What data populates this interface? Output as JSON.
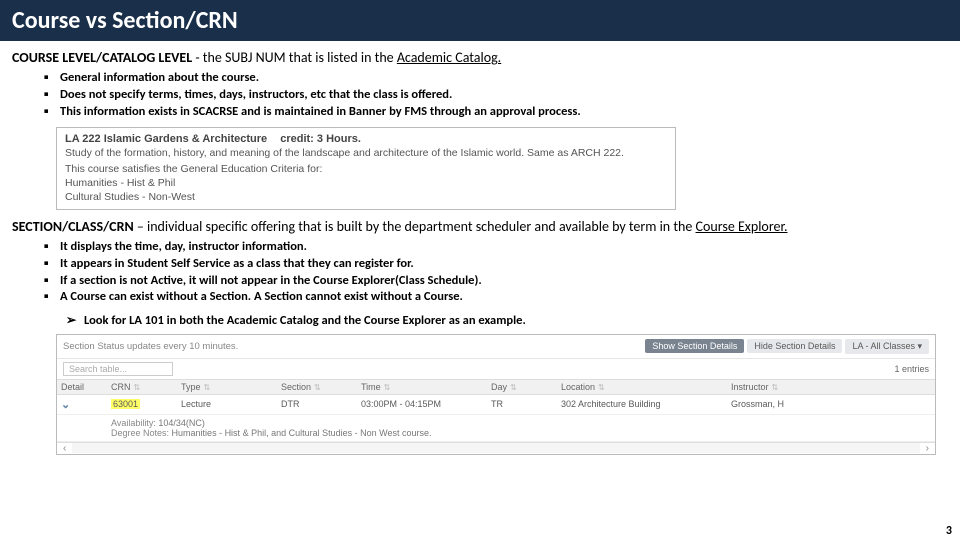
{
  "title": "Course vs Section/CRN",
  "course_level": {
    "heading_bold": "COURSE LEVEL/CATALOG LEVEL",
    "heading_rest": " - the SUBJ NUM that is listed in the ",
    "heading_link": "Academic Catalog.",
    "bullets": [
      "General information about the course.",
      "Does not specify terms, times, days, instructors, etc that the class is offered.",
      "This information exists in SCACRSE and is maintained in Banner by FMS through an approval process."
    ],
    "catalog_box": {
      "code_title": "LA 222   Islamic Gardens & Architecture",
      "credit": "credit: 3 Hours.",
      "desc": "Study of the formation, history, and meaning of the landscape and architecture of the Islamic world. Same as ARCH 222.",
      "gened_intro": "This course satisfies the General Education Criteria for:",
      "tag1": "Humanities - Hist & Phil",
      "tag2": "Cultural Studies - Non-West"
    }
  },
  "section_level": {
    "heading_bold": "SECTION/CLASS/CRN",
    "heading_rest": " – individual specific offering that is built by the department scheduler and available by term in the ",
    "heading_link": "Course Explorer.",
    "bullets": [
      "It displays the time, day, instructor information.",
      "It appears in Student Self Service as a class that they can register for.",
      "If a section is not Active, it will not appear in the Course Explorer(Class Schedule).",
      "A Course can exist without a Section. A Section cannot exist without a Course."
    ],
    "arrow": "Look for LA 101 in both the Academic Catalog and the Course Explorer as an example."
  },
  "explorer": {
    "status_text": "Section Status updates every 10 minutes.",
    "btn_show": "Show Section Details",
    "btn_hide": "Hide Section Details",
    "btn_filter": "LA - All Classes ▾",
    "search_placeholder": "Search table...",
    "entries": "1 entries",
    "headers": [
      "Detail",
      "CRN",
      "Type",
      "Section",
      "Time",
      "Day",
      "Location",
      "Instructor"
    ],
    "row": {
      "crn": "63001",
      "type": "Lecture",
      "section": "DTR",
      "time": "03:00PM - 04:15PM",
      "day": "TR",
      "location": "302 Architecture Building",
      "instructor": "Grossman, H"
    },
    "avail_lbl": "Availability:",
    "avail_val": "104/34(NC)",
    "degree_lbl": "Degree Notes:",
    "degree_val": "Humanities - Hist & Phil, and Cultural Studies - Non West course."
  },
  "page_number": "3"
}
